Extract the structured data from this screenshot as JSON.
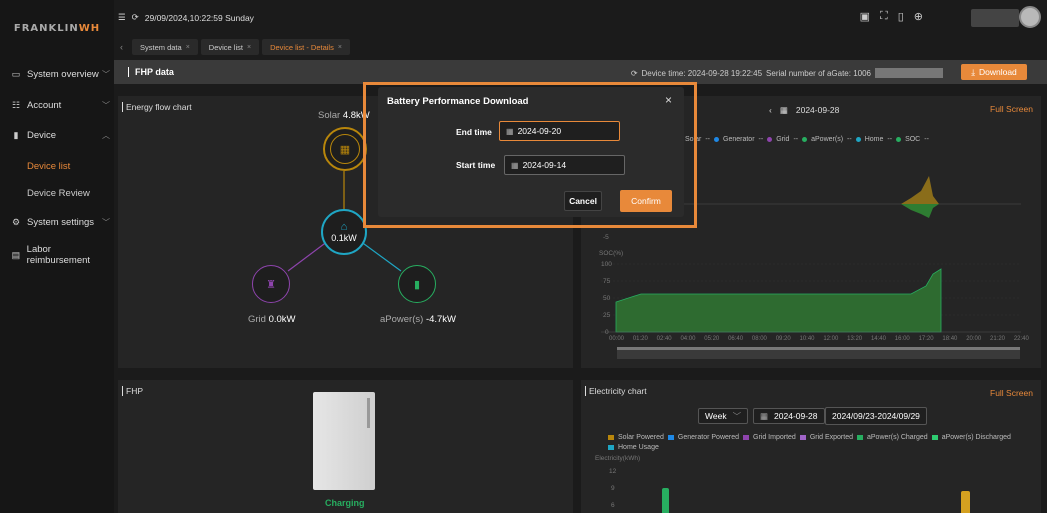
{
  "brand": {
    "logo": "FRANKLINWH"
  },
  "topbar": {
    "datetime": "29/09/2024,10:22:59 Sunday"
  },
  "tabs": [
    {
      "label": "System data"
    },
    {
      "label": "Device list"
    },
    {
      "label": "Device list - Details"
    }
  ],
  "sidebar": {
    "items": [
      {
        "label": "System overview"
      },
      {
        "label": "Account"
      },
      {
        "label": "Device"
      },
      {
        "label": "System settings"
      },
      {
        "label": "Labor reimbursement"
      }
    ],
    "subitems": [
      {
        "label": "Device list"
      },
      {
        "label": "Device Review"
      }
    ]
  },
  "titlebar": {
    "title": "FHP data",
    "device_time": "Device time: 2024-09-28 19:22:45",
    "serial_label": "Serial number of aGate: 1006",
    "download": "Download"
  },
  "energy_flow": {
    "title": "Energy flow chart",
    "solar_label": "Solar",
    "solar_value": "4.8kW",
    "home_value": "0.1kW",
    "grid_label": "Grid",
    "grid_value": "0.0kW",
    "apower_label": "aPower(s)",
    "apower_value": "-4.7kW"
  },
  "power_chart": {
    "date": "2024-09-28",
    "full_screen": "Full Screen",
    "legend": [
      "Solar",
      "Generator",
      "Grid",
      "aPower(s)",
      "Home",
      "SOC"
    ],
    "soc_label": "SOC(%)",
    "y_ticks": [
      "100",
      "75",
      "50",
      "25",
      "0"
    ],
    "neg_tick": "-5",
    "x_ticks": [
      "00:00",
      "01:20",
      "02:40",
      "04:00",
      "05:20",
      "06:40",
      "08:00",
      "09:20",
      "10:40",
      "12:00",
      "13:20",
      "14:40",
      "16:00",
      "17:20",
      "18:40",
      "20:00",
      "21:20",
      "22:40"
    ]
  },
  "fhp_panel": {
    "title": "FHP",
    "status": "Charging"
  },
  "electricity_chart": {
    "title": "Electricity chart",
    "full_screen": "Full Screen",
    "period": "Week",
    "date": "2024-09-28",
    "range": "2024/09/23-2024/09/29",
    "legend": [
      "Solar Powered",
      "Generator Powered",
      "Grid Imported",
      "Grid Exported",
      "aPower(s) Charged",
      "aPower(s) Discharged",
      "Home Usage"
    ],
    "ylabel": "Electricity(kWh)",
    "y_ticks": [
      "12",
      "9",
      "6"
    ]
  },
  "modal": {
    "title": "Battery Performance Download",
    "end_label": "End time",
    "end_value": "2024-09-20",
    "start_label": "Start time",
    "start_value": "2024-09-14",
    "cancel": "Cancel",
    "confirm": "Confirm"
  },
  "colors": {
    "accent": "#e8893a",
    "solar": "#b8860b",
    "grid": "#8e44ad",
    "apower": "#27ae60",
    "home": "#1fa6c4"
  }
}
